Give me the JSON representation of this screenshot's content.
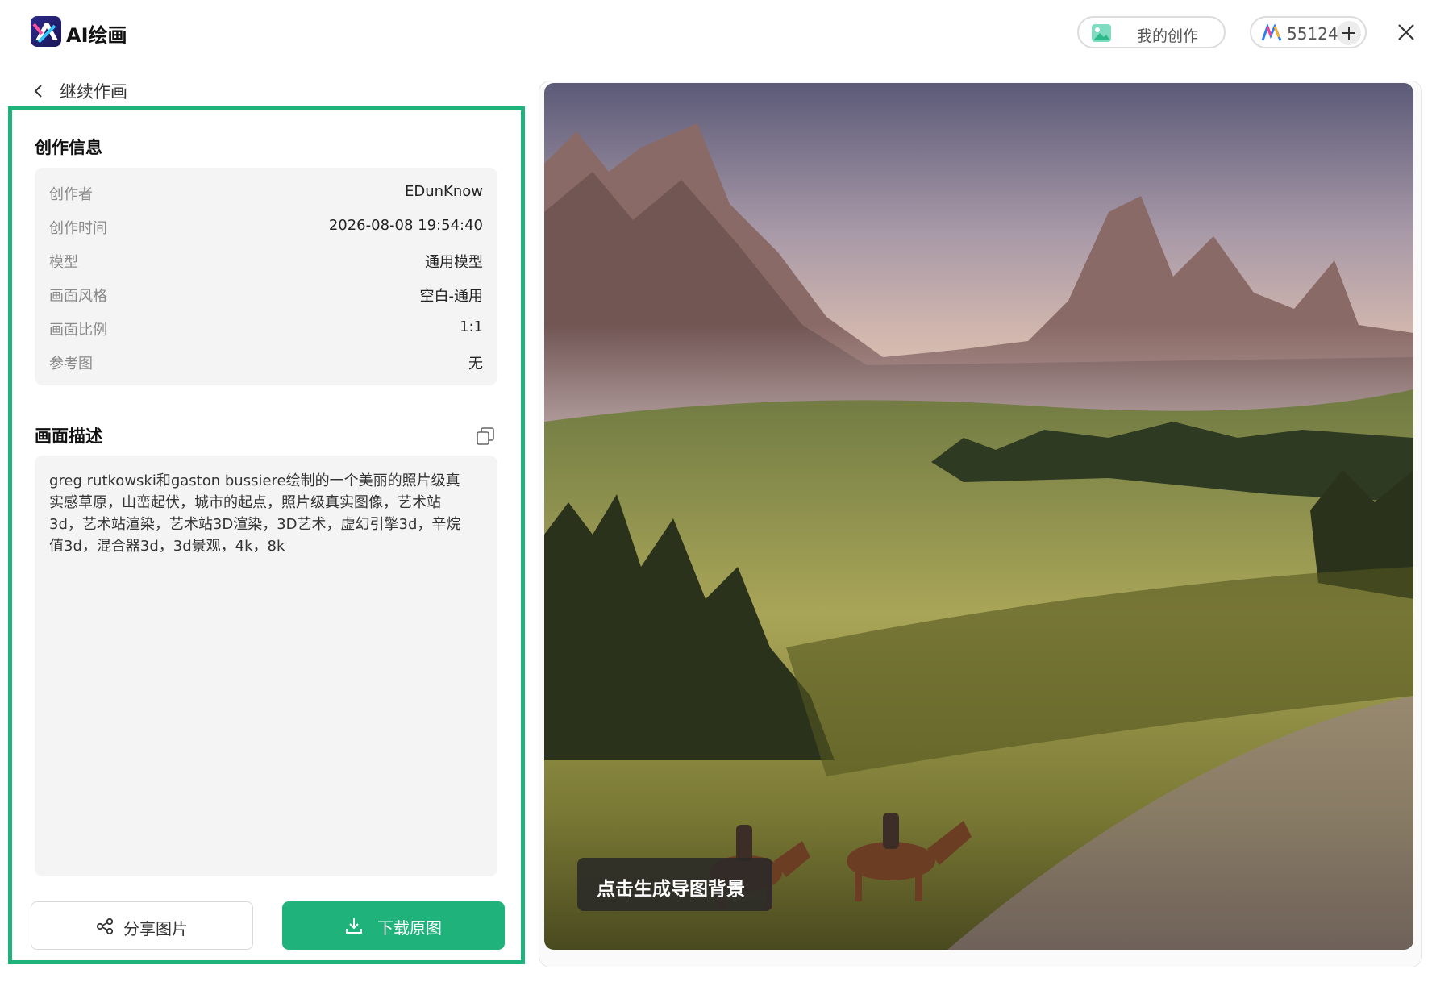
{
  "header": {
    "app_title": "AI绘画",
    "my_works_label": "我的创作",
    "credits": "55124"
  },
  "back": {
    "label": "继续作画"
  },
  "creation_info": {
    "title": "创作信息",
    "rows": [
      {
        "key": "创作者",
        "value": "EDunKnow"
      },
      {
        "key": "创作时间",
        "value": "2026-08-08 19:54:40"
      },
      {
        "key": "模型",
        "value": "通用模型"
      },
      {
        "key": "画面风格",
        "value": "空白-通用"
      },
      {
        "key": "画面比例",
        "value": "1:1"
      },
      {
        "key": "参考图",
        "value": "无"
      }
    ]
  },
  "description": {
    "title": "画面描述",
    "lines": [
      "greg rutkowski和gaston bussiere绘制的一个美丽的照片级真",
      "实感草原，山峦起伏，城市的起点，照片级真实图像，艺术站",
      "3d，艺术站渲染，艺术站3D渲染，3D艺术，虚幻引擎3d，辛烷",
      "值3d，混合器3d，3d景观，4k，8k"
    ]
  },
  "actions": {
    "share_label": "分享图片",
    "download_label": "下载原图"
  },
  "image": {
    "bg_button_label": "点击生成导图背景"
  },
  "colors": {
    "accent": "#1fb27a"
  }
}
